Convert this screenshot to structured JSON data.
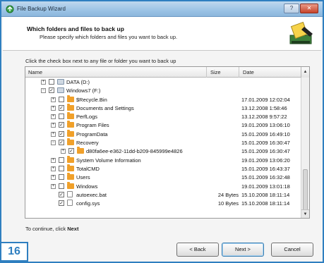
{
  "window": {
    "title": "File Backup Wizard",
    "icons": {
      "app": "backup-icon",
      "wizard": "backup-wizard-icon"
    },
    "controls": {
      "help": "?",
      "close": "✕"
    }
  },
  "header": {
    "title": "Which folders and files to back up",
    "subtitle": "Please specify which folders and files you want to back up."
  },
  "instruction": "Click the check box next to any file or folder you want to back up",
  "tree": {
    "columns": {
      "name": "Name",
      "size": "Size",
      "date": "Date"
    },
    "rows": [
      {
        "name": "DATA (D:)",
        "size": "",
        "date": "",
        "level": 1,
        "expander": "+",
        "checked": false,
        "icon": "drive"
      },
      {
        "name": "Windows7 (F:)",
        "size": "",
        "date": "",
        "level": 1,
        "expander": "−",
        "checked": true,
        "icon": "drive"
      },
      {
        "name": "$Recycle.Bin",
        "size": "",
        "date": "17.01.2009 12:02:04",
        "level": 2,
        "expander": "+",
        "checked": false,
        "icon": "folder"
      },
      {
        "name": "Documents and Settings",
        "size": "",
        "date": "13.12.2008 1:58:46",
        "level": 2,
        "expander": "+",
        "checked": true,
        "icon": "folder"
      },
      {
        "name": "PerfLogs",
        "size": "",
        "date": "13.12.2008 9:57:22",
        "level": 2,
        "expander": "+",
        "checked": false,
        "icon": "folder"
      },
      {
        "name": "Program Files",
        "size": "",
        "date": "19.01.2009 13:06:10",
        "level": 2,
        "expander": "+",
        "checked": true,
        "icon": "folder"
      },
      {
        "name": "ProgramData",
        "size": "",
        "date": "15.01.2009 16:49:10",
        "level": 2,
        "expander": "+",
        "checked": true,
        "icon": "folder"
      },
      {
        "name": "Recovery",
        "size": "",
        "date": "15.01.2009 16:30:47",
        "level": 2,
        "expander": "−",
        "checked": true,
        "icon": "folder"
      },
      {
        "name": "d80fa6ee-e362-11dd-b209-845999e4826",
        "size": "",
        "date": "15.01.2009 16:30:47",
        "level": 3,
        "expander": "+",
        "checked": true,
        "icon": "folder"
      },
      {
        "name": "System Volume Information",
        "size": "",
        "date": "19.01.2009 13:06:20",
        "level": 2,
        "expander": "+",
        "checked": false,
        "icon": "folder"
      },
      {
        "name": "TotalCMD",
        "size": "",
        "date": "15.01.2009 16:43:37",
        "level": 2,
        "expander": "+",
        "checked": false,
        "icon": "folder"
      },
      {
        "name": "Users",
        "size": "",
        "date": "15.01.2009 16:32:48",
        "level": 2,
        "expander": "+",
        "checked": false,
        "icon": "folder"
      },
      {
        "name": "Windows",
        "size": "",
        "date": "19.01.2009 13:01:18",
        "level": 2,
        "expander": "+",
        "checked": false,
        "icon": "folder"
      },
      {
        "name": "autoexec.bat",
        "size": "24 Bytes",
        "date": "15.10.2008 18:11:14",
        "level": 2,
        "expander": "",
        "checked": true,
        "icon": "file"
      },
      {
        "name": "config.sys",
        "size": "10 Bytes",
        "date": "15.10.2008 18:11:14",
        "level": 2,
        "expander": "",
        "checked": true,
        "icon": "file"
      }
    ]
  },
  "footer": {
    "prefix": "To continue, click",
    "emphasis": "Next"
  },
  "buttons": {
    "back": "< Back",
    "next": "Next >",
    "cancel": "Cancel"
  },
  "badge": "16",
  "colors": {
    "accent": "#2f7fc0",
    "folder": "#f0a02a"
  }
}
